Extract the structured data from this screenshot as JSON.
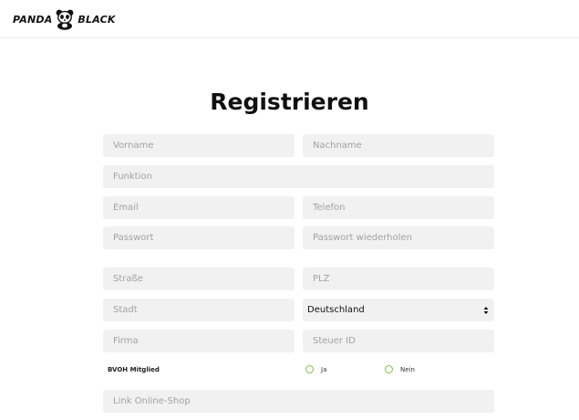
{
  "header": {
    "logo_left": "PANDA",
    "logo_right": "BLACK",
    "logo_icon": "panda-icon"
  },
  "page": {
    "title": "Registrieren"
  },
  "form": {
    "vorname_placeholder": "Vorname",
    "nachname_placeholder": "Nachname",
    "funktion_placeholder": "Funktion",
    "email_placeholder": "Email",
    "telefon_placeholder": "Telefon",
    "passwort_placeholder": "Passwort",
    "passwort2_placeholder": "Passwort wiederholen",
    "strasse_placeholder": "Straße",
    "plz_placeholder": "PLZ",
    "stadt_placeholder": "Stadt",
    "country_selected": "Deutschland",
    "firma_placeholder": "Firma",
    "steuer_placeholder": "Steuer ID",
    "member_label": "BVOH Mitglied",
    "radio_yes": "Ja",
    "radio_no": "Nein",
    "shop_placeholder": "Link Online-Shop"
  },
  "colors": {
    "field_bg": "#f1f1f1",
    "radio_border": "#7cc24a",
    "placeholder": "#a2a2a2"
  }
}
